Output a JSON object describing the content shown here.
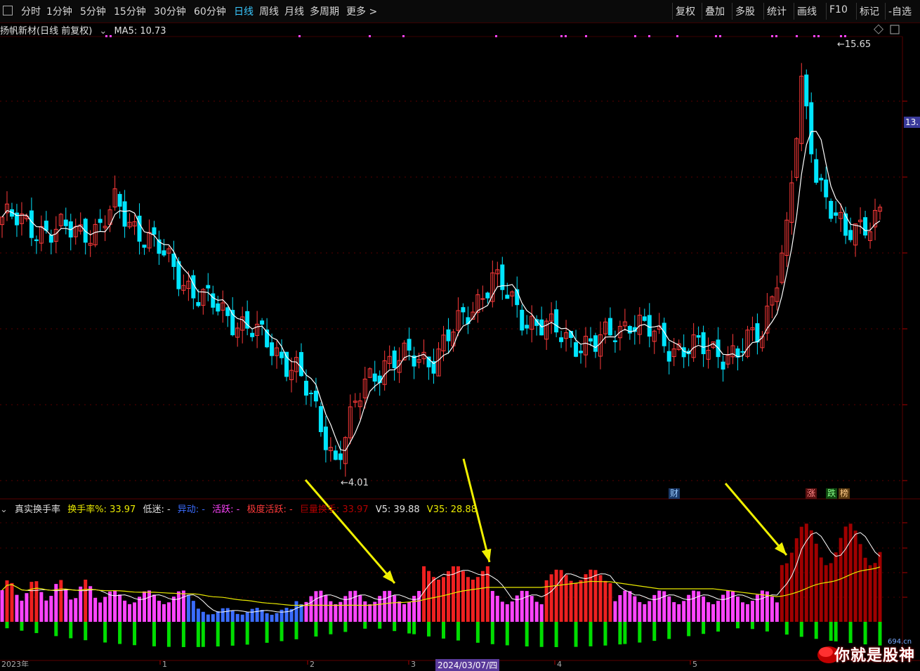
{
  "toolbar": {
    "periods": [
      "分时",
      "1分钟",
      "5分钟",
      "15分钟",
      "30分钟",
      "60分钟",
      "日线",
      "周线",
      "月线",
      "多周期",
      "更多 >"
    ],
    "active_period": "日线",
    "right_buttons": [
      "复权",
      "叠加",
      "多股",
      "统计",
      "画线",
      "F10",
      "标记",
      "-自选"
    ]
  },
  "main_header": {
    "stock_name": "扬帆新材(日线 前复权)",
    "ma_label": "MA5: 10.73"
  },
  "sub_header": {
    "indicator": "真实换手率",
    "turnover": "换手率%: 33.97",
    "low": "低迷: -",
    "abnormal": "异动: -",
    "active": "活跃: -",
    "extreme": "极度活跃: -",
    "huge": "巨量换手: 33.97",
    "v5": "V5: 39.88",
    "v35": "V35: 28.88"
  },
  "annotations": {
    "high": "15.65",
    "low": "4.01",
    "right_price": "13.",
    "fin_badge": "财",
    "zhang_badge": "涨",
    "die_badge": "跌",
    "bang_badge": "榜",
    "date_label": "2024/03/07/四",
    "year_label": "2023年",
    "month_ticks": [
      "1",
      "2",
      "3",
      "4",
      "5"
    ]
  },
  "watermark": {
    "text": "你就是股神",
    "site": "694.cn"
  },
  "colors": {
    "up": "#ff3a3a",
    "down": "#00e5ff",
    "ma": "#ffffff",
    "active_tab": "#39c8ff",
    "magenta": "#ff44ff",
    "yellow": "#e8e800",
    "green": "#00dd00"
  },
  "chart_data": {
    "type": "candlestick",
    "high": 15.65,
    "low": 4.01,
    "ma5_last": 10.73
  }
}
